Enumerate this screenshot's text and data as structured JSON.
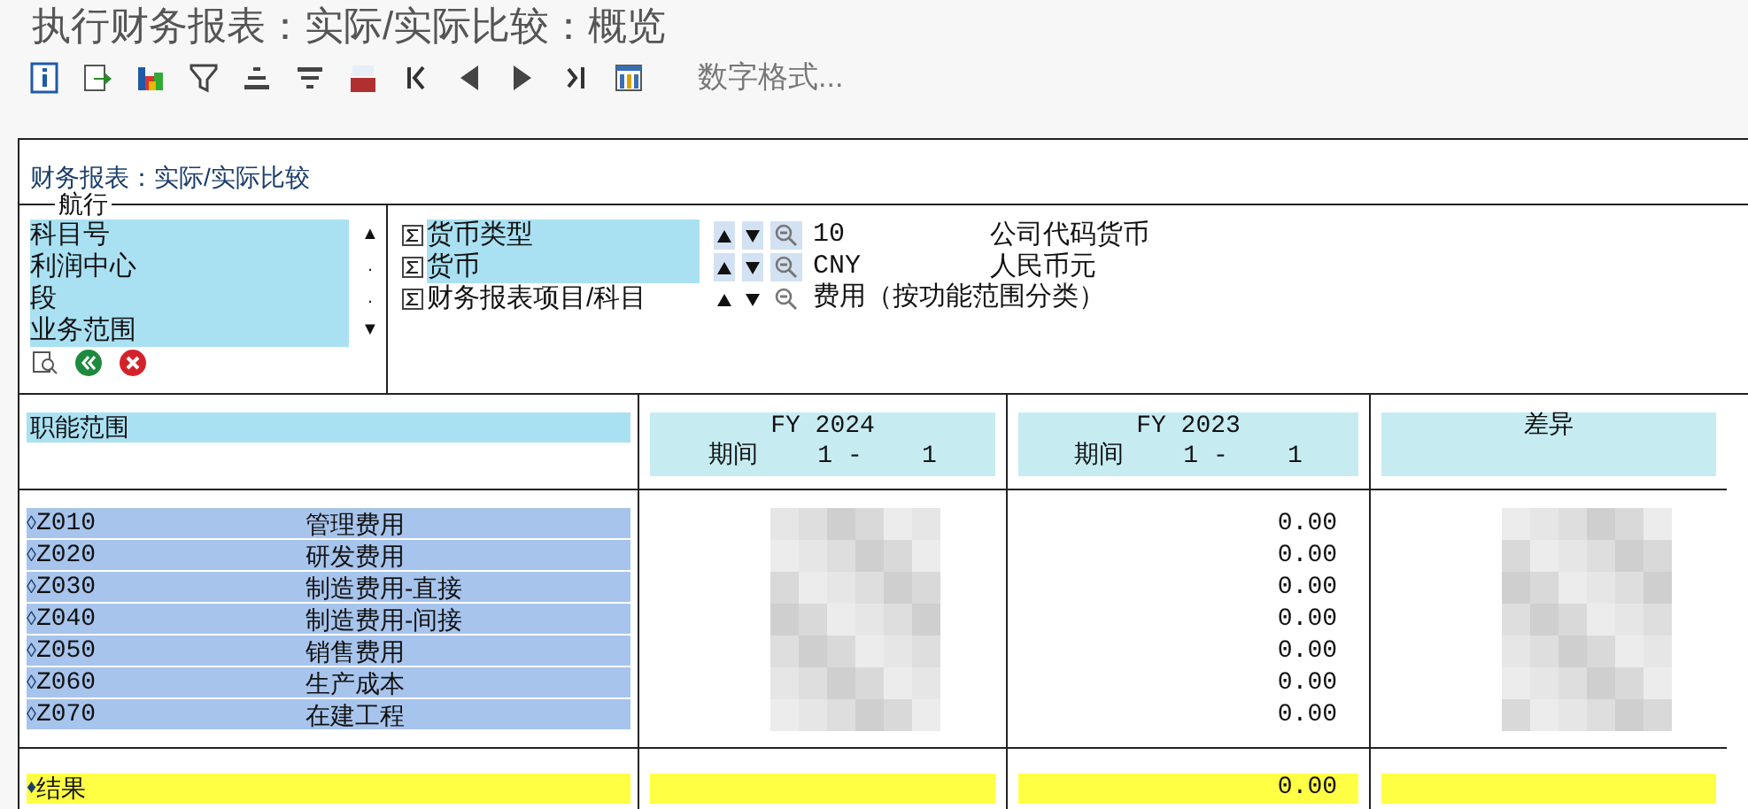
{
  "window": {
    "title": "执行财务报表：实际/实际比较：概览"
  },
  "toolbar": {
    "label": "数字格式..."
  },
  "report_title": "财务报表：实际/实际比较",
  "navigation": {
    "title": "航行",
    "items": [
      "科目号",
      "利润中心",
      "段",
      "业务范围"
    ],
    "scroll_marks": [
      "▲",
      ".",
      ".",
      "▼"
    ]
  },
  "characteristics": [
    {
      "name": "货币类型",
      "highlighted": true,
      "value": "10",
      "description": "公司代码货币"
    },
    {
      "name": "货币",
      "highlighted": true,
      "value": "CNY",
      "description": "人民币元"
    },
    {
      "name": "财务报表项目/科目",
      "highlighted": false,
      "value": "费用（按功能范围分类）"
    }
  ],
  "table": {
    "row_header": "职能范围",
    "columns": [
      {
        "title": "FY 2024",
        "subtitle": "期间    1 -    1"
      },
      {
        "title": "FY 2023",
        "subtitle": "期间    1 -    1"
      },
      {
        "title": "差异"
      }
    ],
    "rows": [
      {
        "marker": "◊",
        "code": "Z010",
        "name": "管理费用",
        "fy2023": "0.00"
      },
      {
        "marker": "◊",
        "code": "Z020",
        "name": "研发费用",
        "fy2023": "0.00"
      },
      {
        "marker": "◊",
        "code": "Z030",
        "name": "制造费用-直接",
        "fy2023": "0.00"
      },
      {
        "marker": "◊",
        "code": "Z040",
        "name": "制造费用-间接",
        "fy2023": "0.00"
      },
      {
        "marker": "◊",
        "code": "Z050",
        "name": "销售费用",
        "fy2023": "0.00"
      },
      {
        "marker": "◊",
        "code": "Z060",
        "name": "生产成本",
        "fy2023": "0.00"
      },
      {
        "marker": "◊",
        "code": "Z070",
        "name": "在建工程",
        "fy2023": "0.00"
      }
    ],
    "result": {
      "marker": "♦",
      "label": "结果",
      "fy2023": "0.00"
    }
  }
}
